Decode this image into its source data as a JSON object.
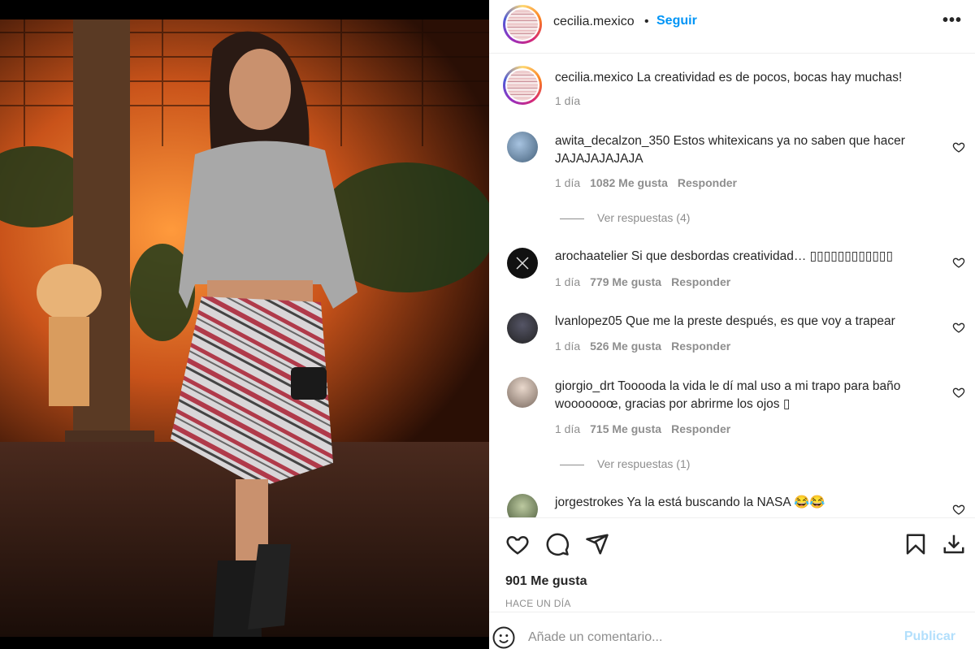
{
  "post": {
    "author": "cecilia.mexico",
    "separator": "•",
    "follow_label": "Seguir",
    "more_label": "•••",
    "caption": {
      "username": "cecilia.mexico",
      "text": "La creatividad es de pocos, bocas hay muchas!",
      "time": "1 día"
    }
  },
  "comments": [
    {
      "username": "awita_decalzon_350",
      "text": "Estos whitexicans ya no saben que hacer JAJAJAJAJAJA",
      "time": "1 día",
      "likes": "1082 Me gusta",
      "reply": "Responder",
      "replies": "Ver respuestas (4)"
    },
    {
      "username": "arochaatelier",
      "text": "Si que desbordas creatividad… ▯▯▯▯▯▯▯▯▯▯▯▯",
      "time": "1 día",
      "likes": "779 Me gusta",
      "reply": "Responder"
    },
    {
      "username": "lvanlopez05",
      "text": "Que me la preste después, es que voy a trapear",
      "time": "1 día",
      "likes": "526 Me gusta",
      "reply": "Responder"
    },
    {
      "username": "giorgio_drt",
      "text": "Tooooda la vida le dí mal uso a mi trapo para baño wooooooœ, gracias por abrirme los ojos ▯",
      "time": "1 día",
      "likes": "715 Me gusta",
      "reply": "Responder",
      "replies": "Ver respuestas (1)"
    },
    {
      "username": "jorgestrokes",
      "text": "Ya la está buscando la NASA 😂😂",
      "time": "",
      "likes": "",
      "reply": ""
    }
  ],
  "actions": {
    "icons": [
      "heart-icon",
      "comment-icon",
      "share-icon",
      "bookmark-icon",
      "download-icon"
    ],
    "likes_total": "901 Me gusta",
    "posted": "HACE UN DÍA"
  },
  "composer": {
    "placeholder": "Añade un comentario...",
    "publish_label": "Publicar"
  },
  "colors": {
    "link_blue": "#0095f6",
    "publish_disabled": "#b2dffc",
    "muted": "#8e8e8e",
    "text": "#262626"
  }
}
